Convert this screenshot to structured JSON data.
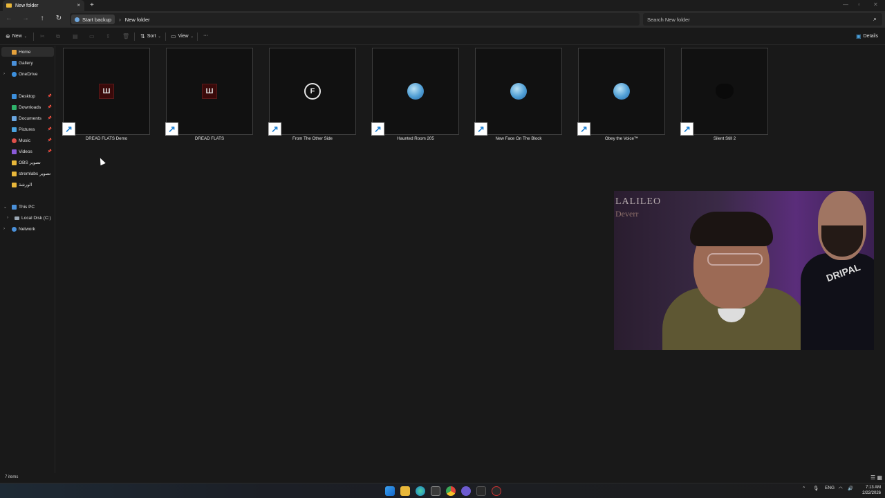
{
  "window": {
    "tab_title": "New folder",
    "new_tab": "+",
    "close_tab": "×"
  },
  "address": {
    "crumbs": [
      "Start backup",
      "New folder"
    ],
    "search_placeholder": "Search New folder"
  },
  "commands": {
    "new_label": "New",
    "sort_label": "Sort",
    "view_label": "View",
    "more_label": "···",
    "details_label": "Details"
  },
  "sidebar": {
    "items": [
      {
        "label": "Home",
        "icon": "home-icon",
        "color": "#e6a23c"
      },
      {
        "label": "Gallery",
        "icon": "gallery-icon",
        "color": "#4a90d9"
      },
      {
        "label": "OneDrive",
        "icon": "cloud-icon",
        "color": "#3c8fdc"
      },
      {
        "label": "Desktop",
        "icon": "desktop-icon",
        "color": "#3c8fdc"
      },
      {
        "label": "Downloads",
        "icon": "download-icon",
        "color": "#2fb36b"
      },
      {
        "label": "Documents",
        "icon": "document-icon",
        "color": "#6aa6e0"
      },
      {
        "label": "Pictures",
        "icon": "pictures-icon",
        "color": "#4aa3e0"
      },
      {
        "label": "Music",
        "icon": "music-icon",
        "color": "#e0504a"
      },
      {
        "label": "Videos",
        "icon": "video-icon",
        "color": "#8a5ad8"
      },
      {
        "label": "OBS تصوير",
        "icon": "folder-icon",
        "color": "#e8b73a"
      },
      {
        "label": "stremlabs تصوير",
        "icon": "folder-icon",
        "color": "#e8b73a"
      },
      {
        "label": "الورشة",
        "icon": "folder-icon",
        "color": "#e8b73a"
      },
      {
        "label": "This PC",
        "icon": "pc-icon",
        "color": "#4a90d9"
      },
      {
        "label": "Local Disk (C:)",
        "icon": "disk-icon",
        "color": "#9aa7b4"
      },
      {
        "label": "Network",
        "icon": "network-icon",
        "color": "#4a90d9"
      }
    ]
  },
  "files": [
    {
      "name": "DREAD FLATS Demo",
      "art": "DF"
    },
    {
      "name": "DREAD FLATS",
      "art": "DF"
    },
    {
      "name": "From The Other Side",
      "art": "F"
    },
    {
      "name": "Haunted Room  205",
      "art": "globe"
    },
    {
      "name": "New Face On The Block",
      "art": "globe"
    },
    {
      "name": "Obey the Voice™",
      "art": "globe"
    },
    {
      "name": "Silent Still 2",
      "art": "mask"
    }
  ],
  "webcam": {
    "wall_text": "LALILEO",
    "wall_text2": "Deverr",
    "shirt_text": "DRIPAL"
  },
  "status": {
    "item_count": "7 items"
  },
  "taskbar": {
    "lang": "ENG",
    "time": "7:13 AM",
    "date": "2/22/2026"
  }
}
